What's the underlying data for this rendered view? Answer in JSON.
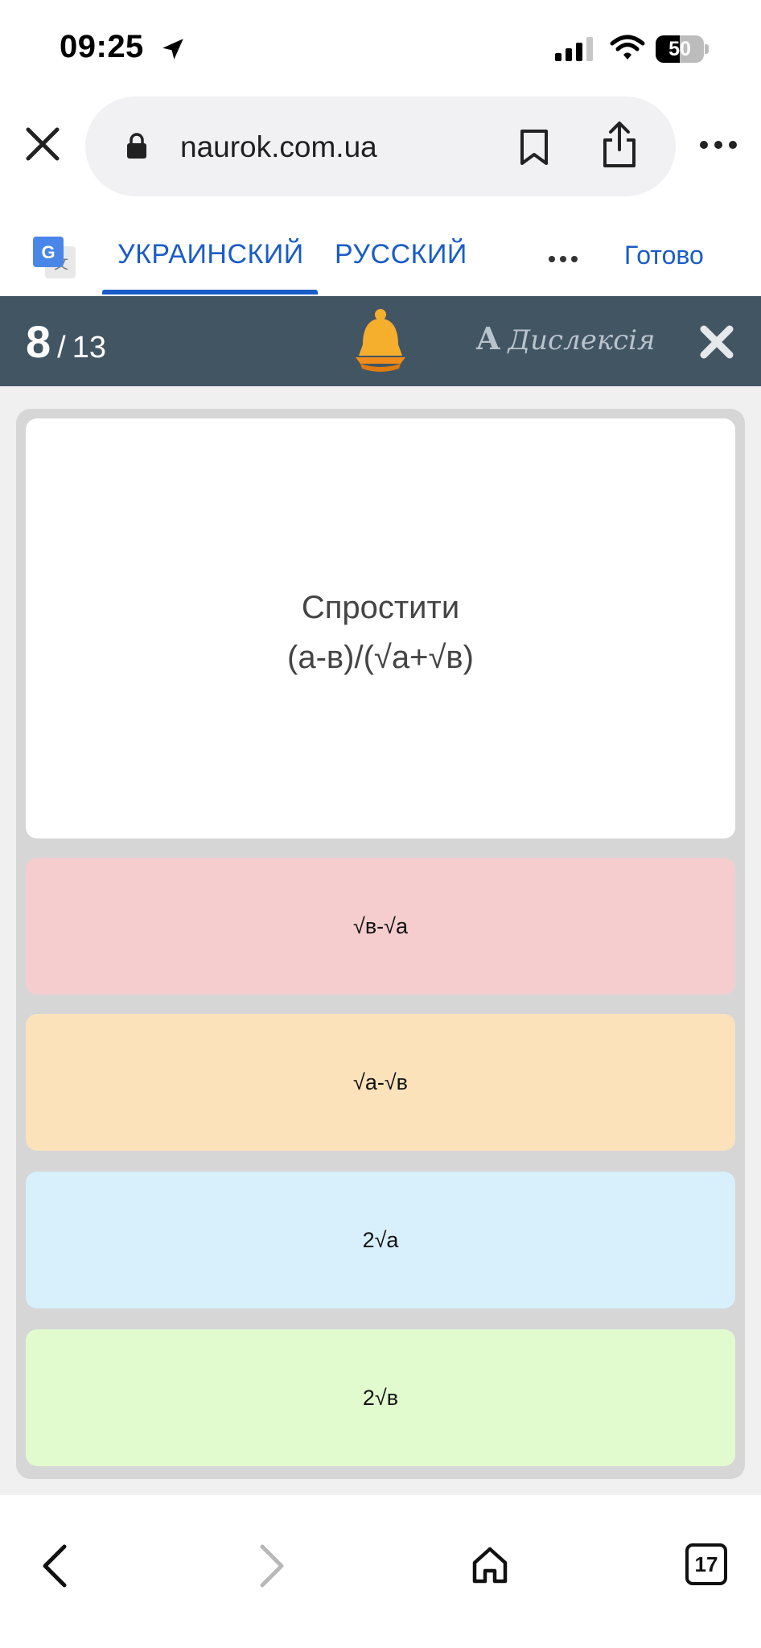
{
  "status_bar": {
    "time": "09:25",
    "battery_level": "50",
    "battery_percent": 0.5,
    "icons": [
      "location-arrow-icon",
      "cellular-signal-icon",
      "wifi-icon",
      "battery-icon"
    ]
  },
  "browser": {
    "url": "naurok.com.ua",
    "icons": [
      "close-icon",
      "lock-icon",
      "bookmark-icon",
      "share-icon",
      "more-icon"
    ]
  },
  "translate": {
    "tabs": [
      "УКРАИНСКИЙ",
      "РУССКИЙ"
    ],
    "active_tab": 0,
    "done_label": "Готово",
    "accent_color": "#1a5cc7"
  },
  "quiz": {
    "current": "8",
    "separator": "/",
    "total": "13",
    "dyslexia_glyph": "A",
    "dyslexia_label": "Дислексія",
    "header_color": "#425563",
    "question_line1": "Спростити",
    "question_line2": "(а-в)/(√а+√в)",
    "answers": [
      {
        "label": "√в-√а",
        "color": "#f6cdcf"
      },
      {
        "label": "√а-√в",
        "color": "#fbe2bb"
      },
      {
        "label": "2√а",
        "color": "#d7f0fb"
      },
      {
        "label": "2√в",
        "color": "#e1fbcf"
      }
    ]
  },
  "toolbar": {
    "tabs_count": "17",
    "icons": [
      "back-icon",
      "forward-icon",
      "home-icon",
      "tabs-icon"
    ]
  }
}
